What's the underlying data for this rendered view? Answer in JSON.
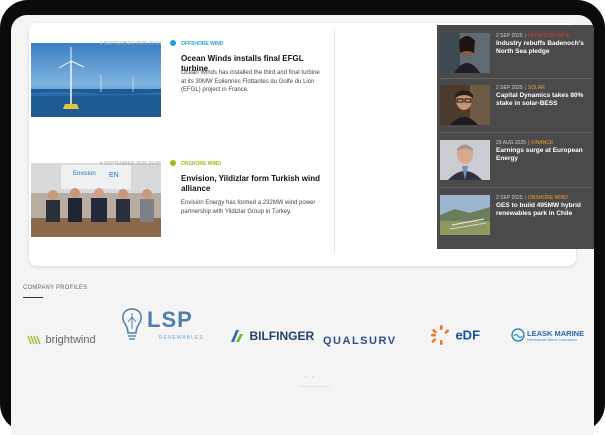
{
  "articles": [
    {
      "date": "4 SEPTEMBER 2025 09:24",
      "category": "OFFSHORE WIND",
      "category_color": "#1fa3c9",
      "title": "Ocean Winds installs final EFGL turbine",
      "summary": "Ocean Winds has installed the third and final turbine at its 30MW Eoliennes Flottantes du Golfe du Lion (EFGL) project in France."
    },
    {
      "date": "4 SEPTEMBER 2025 09:05",
      "category": "ONSHORE WIND",
      "category_color": "#a7b70f",
      "title": "Envision, Yildizlar form Turkish wind alliance",
      "summary": "Envision Energy has formed a 232MW wind power partnership with Yildizlar Group in Turkey."
    }
  ],
  "sidebar": [
    {
      "date": "2 SEP 2025",
      "category": "OFFSHORE WIND",
      "category_color": "#e23b2e",
      "title": "Industry rebuffs Badenoch's North Sea pledge"
    },
    {
      "date": "2 SEP 2025",
      "category": "SOLAR",
      "category_color": "#f0a030",
      "title": "Capital Dynamics takes 80% stake in solar-BESS"
    },
    {
      "date": "29 AUG 2025",
      "category": "FINANCE",
      "category_color": "#f0a030",
      "title": "Earnings surge at European Energy"
    },
    {
      "date": "2 SEP 2025",
      "category": "ONSHORE WIND",
      "category_color": "#f0a030",
      "title": "GES to build 495MW hybrid renewables park in Chile"
    }
  ],
  "company_profiles": {
    "heading": "COMPANY PROFILES",
    "logos": [
      {
        "name": "brightwind",
        "icon": "wind-lines-icon"
      },
      {
        "name": "LSP",
        "sub": "RENEWABLES",
        "icon": "lightbulb-icon"
      },
      {
        "name": "BILFINGER",
        "icon": "bilfinger-mark-icon"
      },
      {
        "name": "QUALSURV"
      },
      {
        "name": "eDF",
        "icon": "edf-sun-icon"
      },
      {
        "name": "LEASK MARINE",
        "sub": "International Marine Contractors",
        "icon": "leask-wave-icon"
      }
    ],
    "pager": "• •"
  }
}
